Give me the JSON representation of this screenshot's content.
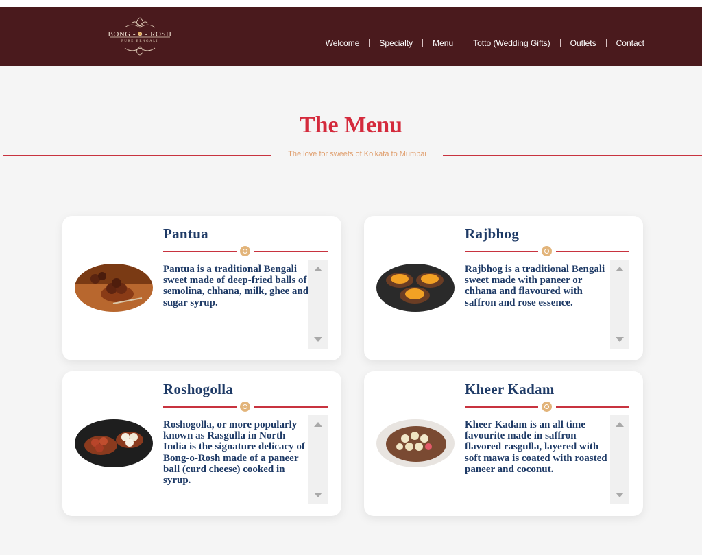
{
  "header": {
    "logo": {
      "text": "BONG - ○ - ROSH",
      "subtext": "PURE BENGALI"
    },
    "nav": [
      {
        "label": "Welcome"
      },
      {
        "label": "Specialty"
      },
      {
        "label": "Menu"
      },
      {
        "label": "Totto (Wedding Gifts)"
      },
      {
        "label": "Outlets"
      },
      {
        "label": "Contact"
      }
    ]
  },
  "main": {
    "title": "The Menu",
    "subtitle": "The love for sweets of Kolkata to Mumbai",
    "items": [
      {
        "name": "Pantua",
        "description": "Pantua is a traditional Bengali sweet made of deep-fried balls of semolina, chhana, milk, ghee and sugar syrup."
      },
      {
        "name": "Rajbhog",
        "description": "Rajbhog is a traditional Bengali sweet made with paneer or chhana and flavoured with saffron and rose essence."
      },
      {
        "name": "Roshogolla",
        "description": "Roshogolla, or more popularly known as Rasgulla in North India is the signature delicacy of Bong-o-Rosh made of a paneer ball (curd cheese) cooked in syrup."
      },
      {
        "name": "Kheer Kadam",
        "description": "Kheer Kadam is an all time favourite made in saffron flavored rasgulla, layered with soft mawa is coated with roasted paneer and coconut."
      }
    ]
  },
  "colors": {
    "header_bg": "#4a1a1d",
    "title": "#d42a3c",
    "subtitle": "#e0a070",
    "card_text": "#1e3a66",
    "accent_line": "#c8333f",
    "divider_dot": "#e2b47a"
  },
  "icons": {
    "divider_ornament": "circle-ornament-icon",
    "scroll_up": "triangle-up-icon",
    "scroll_down": "triangle-down-icon"
  }
}
